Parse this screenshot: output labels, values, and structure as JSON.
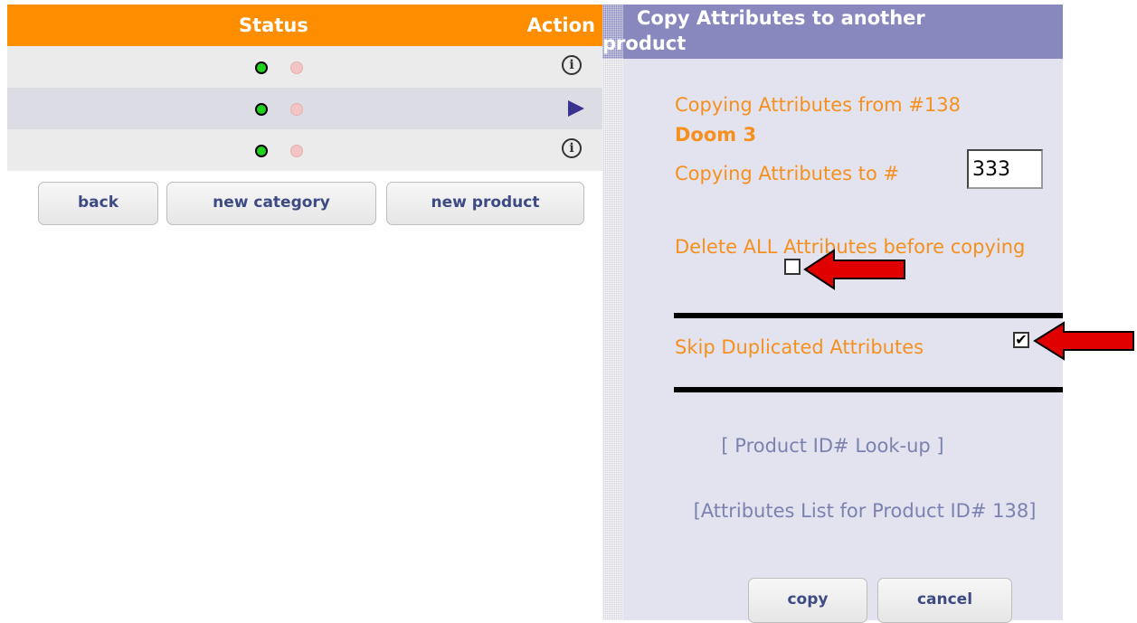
{
  "product_list": {
    "headers": {
      "status": "Status",
      "action": "Action"
    },
    "rows": [
      {
        "status_active": true,
        "action_icon": "info-icon"
      },
      {
        "status_active": true,
        "action_icon": "play-icon"
      },
      {
        "status_active": true,
        "action_icon": "info-icon"
      }
    ],
    "buttons": {
      "back": "back",
      "new_category": "new category",
      "new_product": "new product"
    }
  },
  "copy_panel": {
    "title": "Copy Attributes to another product",
    "copying_from": "Copying Attributes from #138",
    "product_name": "Doom 3",
    "copying_to_label": "Copying Attributes to #",
    "copying_to_value": "333",
    "delete_label": "Delete ALL Attributes before copying",
    "delete_checked": false,
    "skip_label": "Skip Duplicated Attributes",
    "skip_checked": true,
    "skip_check_glyph": "✔",
    "lookup_link": "[ Product ID# Look-up ]",
    "attributes_list_link": "[Attributes List for Product ID# 138]",
    "buttons": {
      "copy": "copy",
      "cancel": "cancel"
    }
  },
  "colors": {
    "header_orange": "#ff8d00",
    "panel_header": "#8988be",
    "panel_background": "#e3e3ef",
    "label_orange": "#f5901e",
    "link_blue": "#7b82b0",
    "arrow_red": "#e00000",
    "status_green": "#1ed21e"
  },
  "annotations": {
    "arrows": [
      "red-arrow-icon",
      "red-arrow-icon"
    ]
  }
}
